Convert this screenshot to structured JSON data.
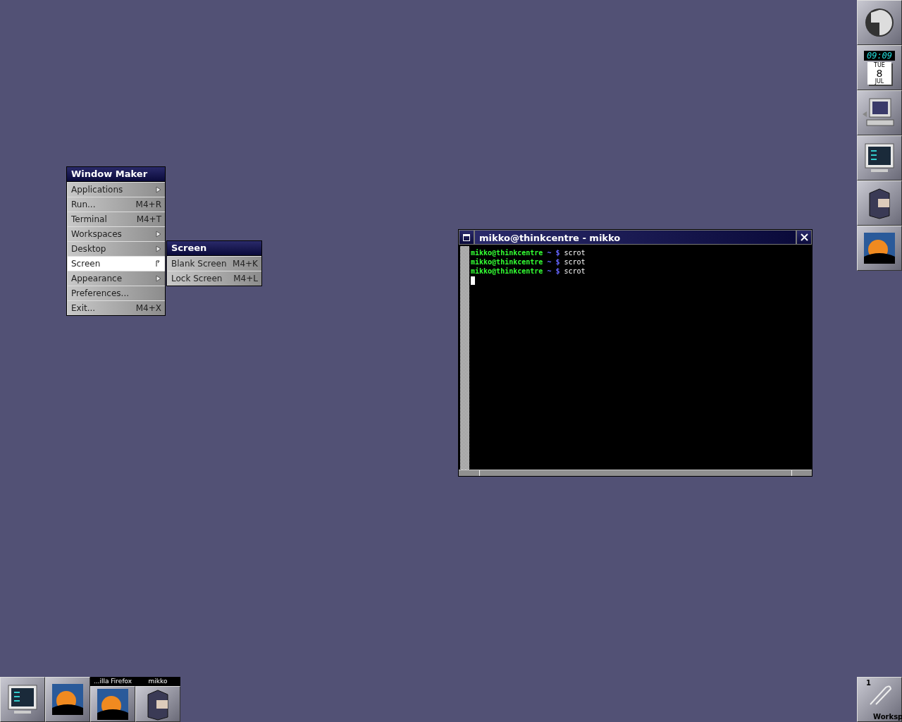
{
  "root_menu": {
    "title": "Window Maker",
    "items": [
      {
        "label": "Applications",
        "submenu": true,
        "selected": false
      },
      {
        "label": "Run...",
        "shortcut": "M4+R",
        "submenu": false,
        "selected": false
      },
      {
        "label": "Terminal",
        "shortcut": "M4+T",
        "submenu": false,
        "selected": false
      },
      {
        "label": "Workspaces",
        "submenu": true,
        "selected": false
      },
      {
        "label": "Desktop",
        "submenu": true,
        "selected": false
      },
      {
        "label": "Screen",
        "submenu": true,
        "selected": true
      },
      {
        "label": "Appearance",
        "submenu": true,
        "selected": false
      },
      {
        "label": "Preferences...",
        "submenu": false,
        "selected": false
      },
      {
        "label": "Exit...",
        "shortcut": "M4+X",
        "submenu": false,
        "selected": false
      }
    ]
  },
  "submenu": {
    "title": "Screen",
    "items": [
      {
        "label": "Blank Screen",
        "shortcut": "M4+K",
        "selected": false
      },
      {
        "label": "Lock Screen",
        "shortcut": "M4+L",
        "selected": false
      }
    ]
  },
  "terminal": {
    "title": "mikko@thinkcentre - mikko",
    "lines": [
      {
        "user_host": "mikko@thinkcentre",
        "dir": "~",
        "prompt": "$",
        "command": "scrot"
      },
      {
        "user_host": "mikko@thinkcentre",
        "dir": "~",
        "prompt": "$",
        "command": "scrot"
      },
      {
        "user_host": "mikko@thinkcentre",
        "dir": "~",
        "prompt": "$",
        "command": "scrot"
      }
    ]
  },
  "dock": [
    {
      "kind": "logo"
    },
    {
      "kind": "clock",
      "time": "09:09",
      "day": "TUE",
      "date": "8",
      "month": "JUL"
    },
    {
      "kind": "computer"
    },
    {
      "kind": "terminal"
    },
    {
      "kind": "cabinet"
    },
    {
      "kind": "firefox"
    }
  ],
  "appicons": [
    {
      "kind": "terminal"
    },
    {
      "kind": "firefox"
    },
    {
      "kind": "firefox",
      "label": "...illa Firefox"
    },
    {
      "kind": "cabinet",
      "label": "mikko"
    }
  ],
  "clip": {
    "number": "1",
    "name": "Worksp"
  }
}
